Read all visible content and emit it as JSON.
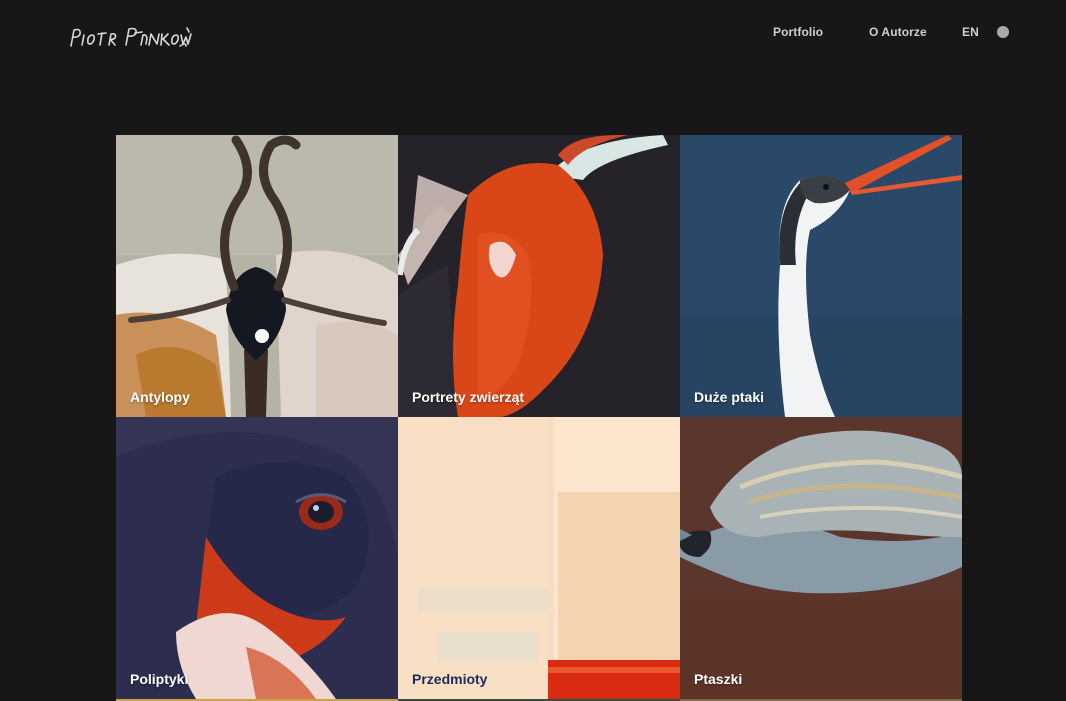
{
  "header": {
    "logo_text": "Piotr Pańkowski",
    "nav": [
      {
        "label": "Portfolio"
      },
      {
        "label": "O Autorze"
      },
      {
        "label": "EN"
      }
    ]
  },
  "gallery": {
    "tiles": [
      {
        "label": "Antylopy",
        "icon": "antelope-painting"
      },
      {
        "label": "Portrety zwierząt",
        "icon": "animal-portrait-painting"
      },
      {
        "label": "Duże ptaki",
        "icon": "heron-painting"
      },
      {
        "label": "Poliptyki",
        "icon": "bird-eye-painting"
      },
      {
        "label": "Przedmioty",
        "icon": "objects-painting"
      },
      {
        "label": "Ptaszki",
        "icon": "small-bird-painting"
      }
    ]
  },
  "colors": {
    "background": "#171717",
    "nav_text": "#cfcfcf",
    "label_light": "#ffffff",
    "label_dark": "#1e2a5c"
  }
}
